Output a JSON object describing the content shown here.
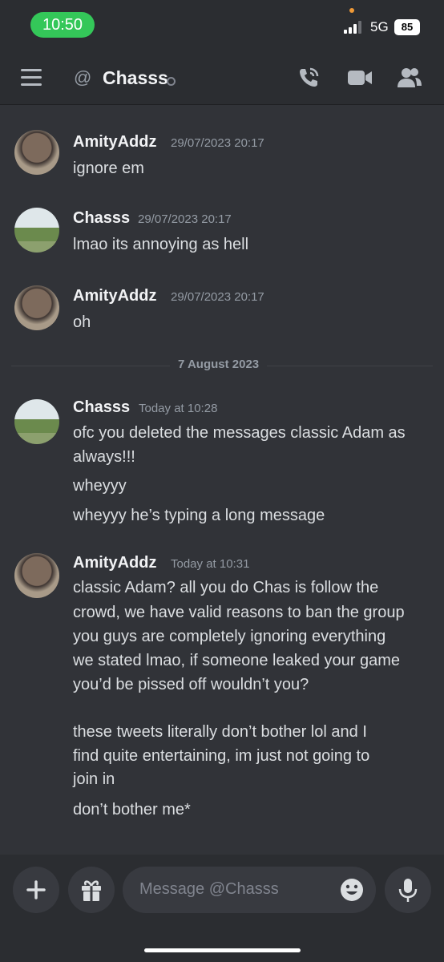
{
  "status_bar": {
    "time": "10:50",
    "network": "5G",
    "battery": "85"
  },
  "header": {
    "at_symbol": "@",
    "channel_name": "Chasss"
  },
  "messages": [
    {
      "author": "AmityAddz",
      "timestamp": "29/07/2023 20:17",
      "lines": [
        "ignore em"
      ]
    },
    {
      "author": "Chasss",
      "timestamp": "29/07/2023 20:17",
      "lines": [
        "lmao its annoying as hell"
      ]
    },
    {
      "author": "AmityAddz",
      "timestamp": "29/07/2023 20:17",
      "lines": [
        "oh"
      ]
    },
    {
      "author": "Chasss",
      "timestamp": "Today at 10:28",
      "lines": [
        "ofc you deleted the messages classic Adam as",
        "always!!!",
        "wheyyy",
        "wheyyy he’s typing a long message"
      ]
    },
    {
      "author": "AmityAddz",
      "timestamp": "Today at 10:31",
      "lines": [
        "classic Adam? all you do Chas is follow the",
        "crowd, we have valid reasons to ban the group",
        "you guys are completely ignoring everything",
        "we stated lmao, if someone leaked your game",
        "you’d be pissed off wouldn’t you?",
        "these tweets literally don’t bother lol and I",
        "find quite entertaining, im just not going to",
        "join in",
        "don’t bother me*"
      ]
    }
  ],
  "date_divider": "7 August 2023",
  "composer": {
    "placeholder": "Message @Chasss"
  },
  "icons": [
    "hamburger-icon",
    "at-icon",
    "call-icon",
    "video-icon",
    "members-icon",
    "plus-icon",
    "gift-icon",
    "emoji-icon",
    "microphone-icon"
  ],
  "colors": {
    "background": "#313338",
    "bar": "#2b2d31",
    "online_pill": "#34c759"
  }
}
